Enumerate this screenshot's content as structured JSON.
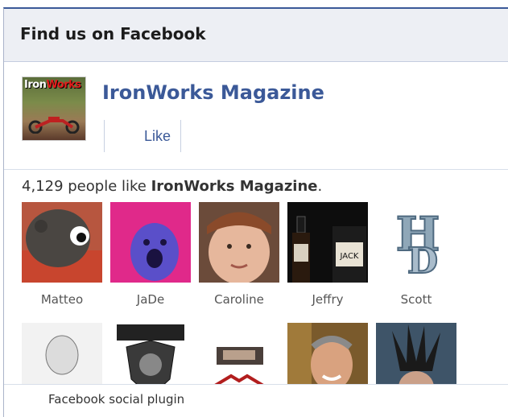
{
  "header": {
    "title": "Find us on Facebook"
  },
  "page": {
    "thumb_title_a": "Iron",
    "thumb_title_b": "Works",
    "name": "IronWorks Magazine",
    "like_label": "Like"
  },
  "fans_summary": {
    "count": "4,129",
    "text": " people like ",
    "page_name": "IronWorks Magazine",
    "end": "."
  },
  "fans": [
    {
      "name": "Matteo",
      "icon": "plush-toy-photo"
    },
    {
      "name": "JaDe",
      "icon": "face-photo-pink"
    },
    {
      "name": "Caroline",
      "icon": "child-face-photo"
    },
    {
      "name": "Jeffry",
      "icon": "whiskey-bottle-photo"
    },
    {
      "name": "Scott",
      "icon": "hd-logo"
    },
    {
      "name": "",
      "icon": "sketch-portrait"
    },
    {
      "name": "",
      "icon": "emblem-logo"
    },
    {
      "name": "",
      "icon": "car-emblem"
    },
    {
      "name": "",
      "icon": "man-smiling-photo"
    },
    {
      "name": "",
      "icon": "mohawk-photo"
    }
  ],
  "footer": {
    "text": "Facebook social plugin"
  },
  "colors": {
    "brand": "#3b5998",
    "header_bg": "#edeff4"
  }
}
